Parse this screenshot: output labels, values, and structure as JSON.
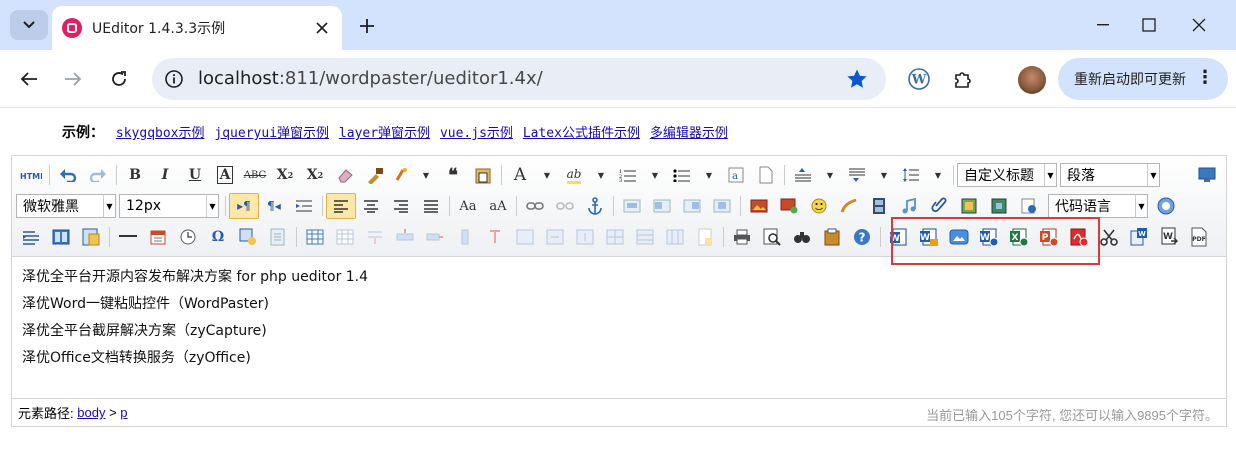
{
  "browser": {
    "tab_title": "UEditor 1.4.3.3示例",
    "url_host": "localhost",
    "url_path": ":811/wordpaster/ueditor1.4x/",
    "update_label": "重新启动即可更新",
    "accent": "#d3e3fd"
  },
  "page": {
    "links_label": "示例：",
    "links": [
      "skygqbox示例",
      "jqueryui弹窗示例",
      "layer弹窗示例",
      "vue.js示例",
      "Latex公式插件示例",
      "多编辑器示例"
    ]
  },
  "editor": {
    "title_select": "自定义标题",
    "paragraph_select": "段落",
    "font_select": "微软雅黑",
    "size_select": "12px",
    "code_select": "代码语言",
    "content": [
      "泽优全平台开源内容发布解决方案 for php ueditor 1.4",
      "泽优Word一键粘贴控件（WordPaster)",
      "泽优全平台截屏解决方案（zyCapture)",
      "泽优Office文档转换服务（zyOffice)"
    ],
    "path_label": "元素路径:",
    "path_body": "body",
    "path_sep": ">",
    "path_p": "p",
    "counter": "当前已输入105个字符, 您还可以输入9895个字符。",
    "highlight_color": "#d8393a"
  }
}
